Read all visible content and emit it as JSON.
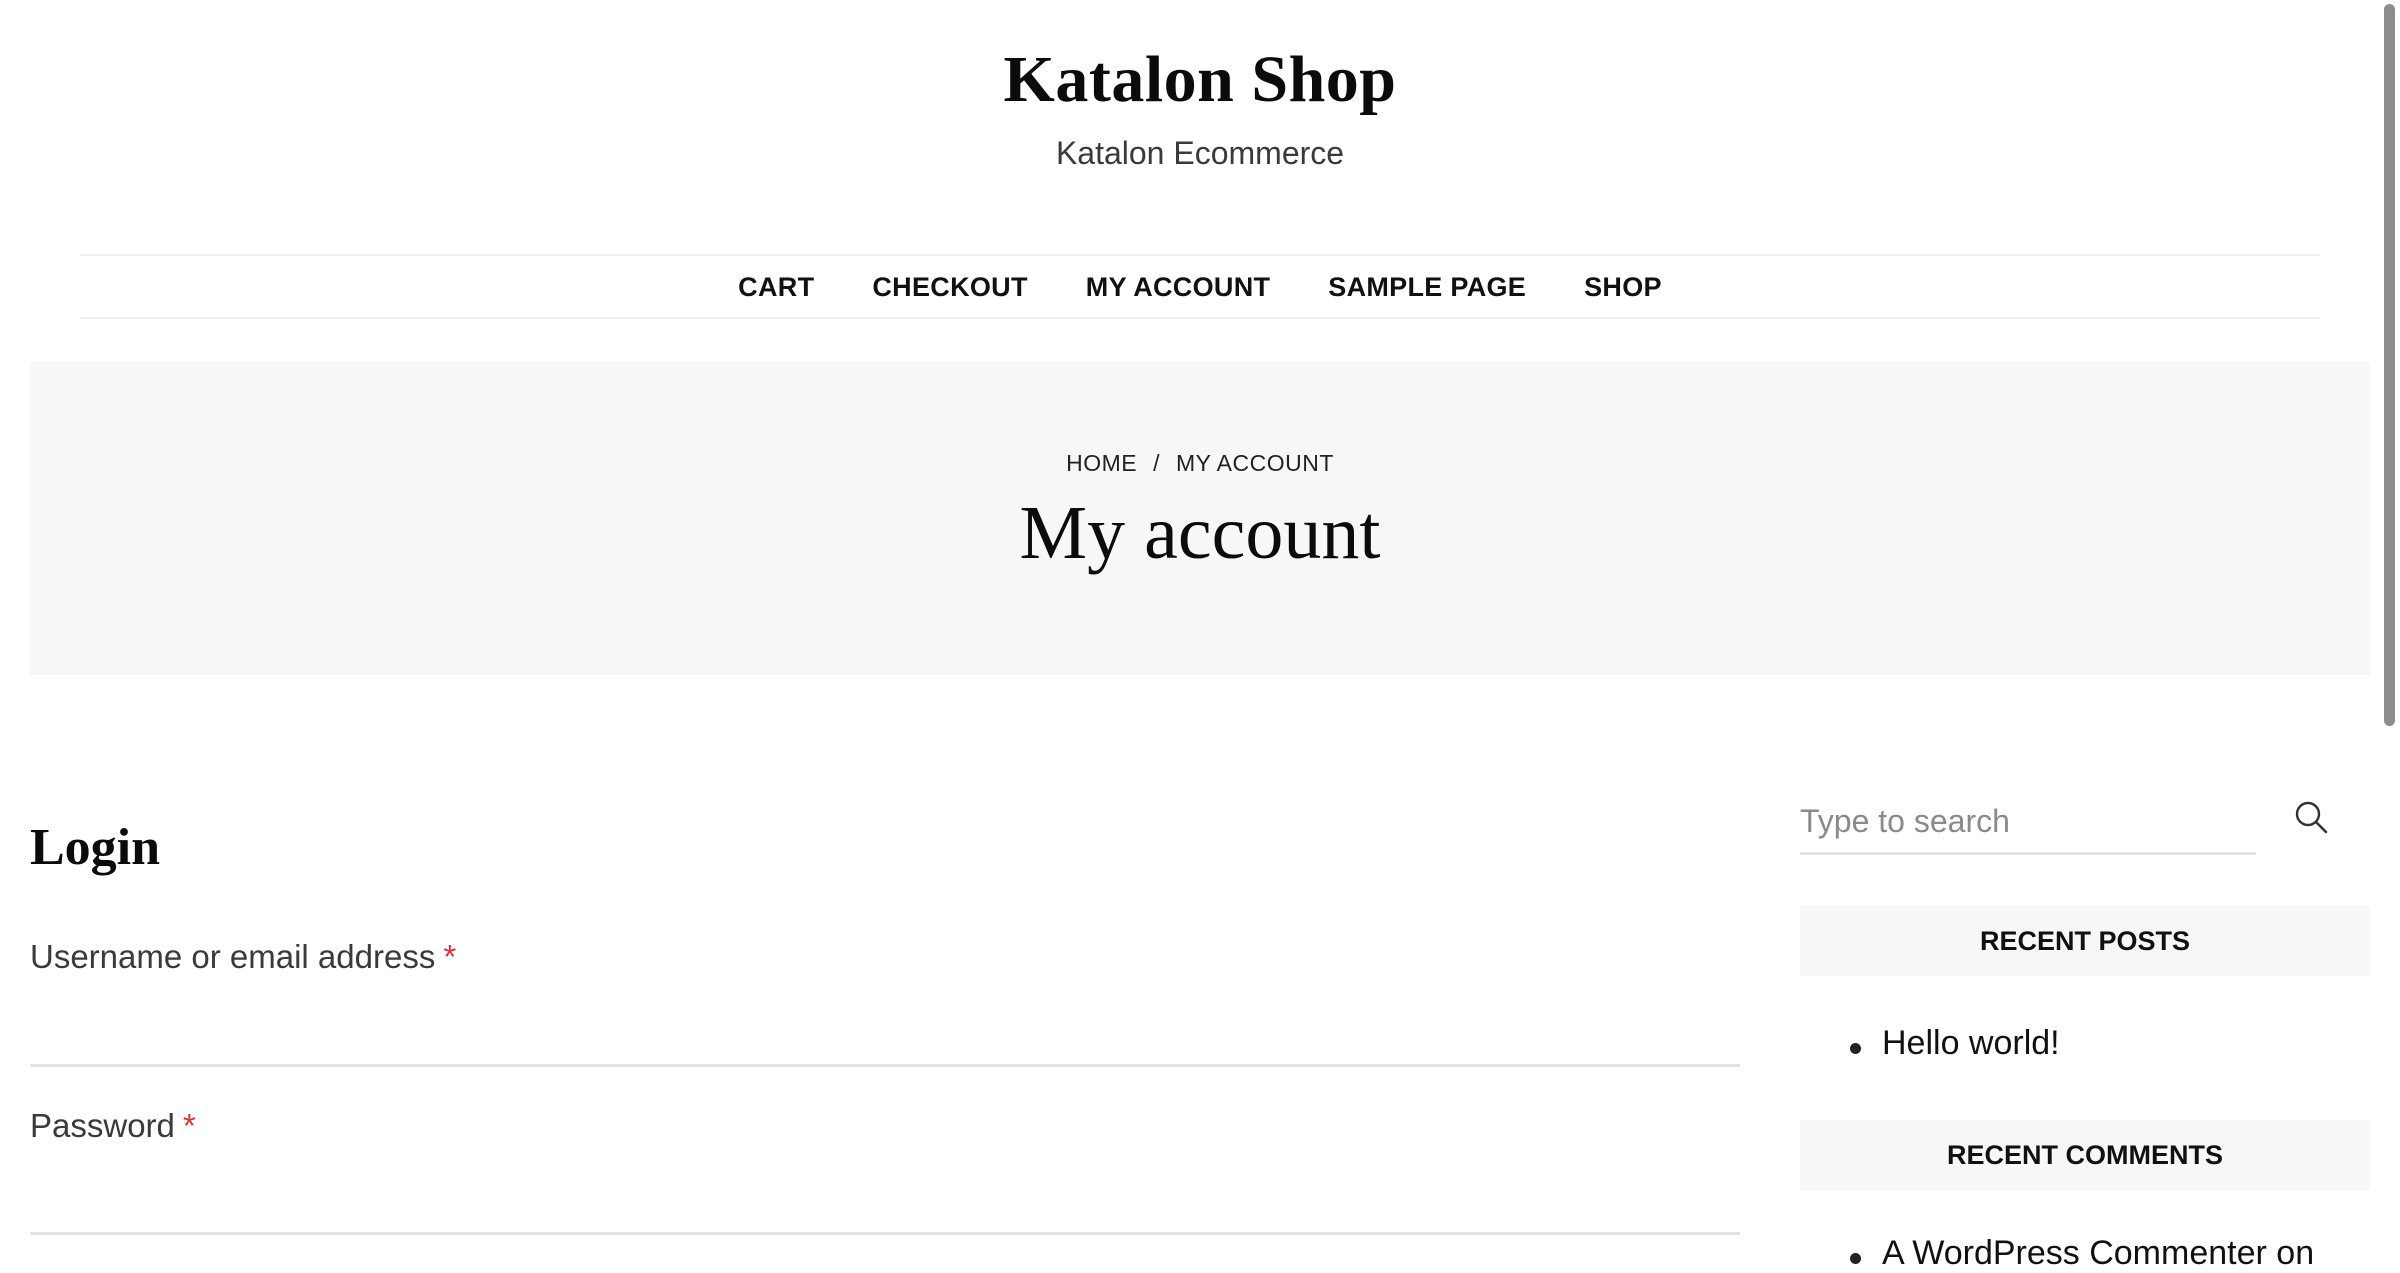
{
  "header": {
    "site_title": "Katalon Shop",
    "tagline": "Katalon Ecommerce"
  },
  "nav": {
    "items": [
      {
        "label": "CART"
      },
      {
        "label": "CHECKOUT"
      },
      {
        "label": "MY ACCOUNT"
      },
      {
        "label": "SAMPLE PAGE"
      },
      {
        "label": "SHOP"
      }
    ]
  },
  "breadcrumb": {
    "home": "HOME",
    "separator": "/",
    "current": "MY ACCOUNT"
  },
  "page": {
    "title": "My account"
  },
  "login": {
    "heading": "Login",
    "username_label": "Username or email address",
    "password_label": "Password",
    "required_marker": "*",
    "username_value": "",
    "password_value": ""
  },
  "sidebar": {
    "search": {
      "placeholder": "Type to search",
      "value": "",
      "icon": "search-icon"
    },
    "recent_posts": {
      "title": "RECENT POSTS",
      "items": [
        {
          "label": "Hello world!"
        }
      ]
    },
    "recent_comments": {
      "title": "RECENT COMMENTS",
      "items": [
        {
          "author": "A WordPress Commenter",
          "joiner": "on"
        }
      ]
    }
  },
  "colors": {
    "band_background": "#f7f7f7",
    "required": "#d63638",
    "text": "#111111"
  }
}
